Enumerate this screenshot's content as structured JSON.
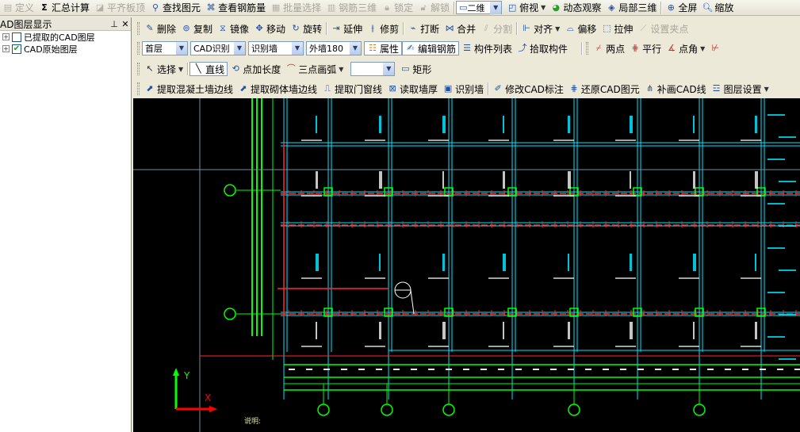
{
  "toolbar1": {
    "define": "定义",
    "sum_calc": "汇总计算",
    "flat_board": "平齐板顶",
    "find_elem": "查找图元",
    "view_rebar": "查看钢筋量",
    "batch_select": "批量选择",
    "rebar_3d": "钢筋三维",
    "lock": "锁定",
    "unlock": "解锁",
    "view_mode": "二维",
    "top_view": "俯视",
    "dynamic_view": "动态观察",
    "local_3d": "局部三维",
    "fullscreen": "全屏",
    "zoom": "缩放"
  },
  "panel": {
    "title": "AD图层显示",
    "items": [
      {
        "label": "已提取的CAD图层",
        "checked": false
      },
      {
        "label": "CAD原始图层",
        "checked": true
      }
    ]
  },
  "toolbar2": {
    "delete": "删除",
    "copy": "复制",
    "mirror": "镜像",
    "move": "移动",
    "rotate": "旋转",
    "extend": "延伸",
    "trim": "修剪",
    "break": "打断",
    "merge": "合并",
    "split": "分割",
    "align": "对齐",
    "offset": "偏移",
    "stretch": "拉伸",
    "set_grip": "设置夹点"
  },
  "toolbar3": {
    "floor": "首层",
    "cad_recog": "CAD识别",
    "recog_wall": "识别墙",
    "wall_type": "外墙180",
    "properties": "属性",
    "edit_rebar": "编辑钢筋",
    "component_list": "构件列表",
    "pick_component": "拾取构件",
    "two_points": "两点",
    "parallel": "平行",
    "point_angle": "点角"
  },
  "toolbar4": {
    "select": "选择",
    "line": "直线",
    "add_length": "点加长度",
    "three_point_arc": "三点画弧",
    "rectangle": "矩形"
  },
  "toolbar5": {
    "extract_concrete": "提取混凝土墙边线",
    "extract_masonry": "提取砌体墙边线",
    "extract_door": "提取门窗线",
    "read_thickness": "读取墙厚",
    "recog_wall": "识别墙",
    "modify_cad": "修改CAD标注",
    "restore_cad": "还原CAD图元",
    "draw_cad_line": "补画CAD线",
    "layer_settings": "图层设置"
  },
  "canvas": {
    "axis_y": "Y",
    "axis_x": "X",
    "note": "说明:"
  },
  "colors": {
    "canvas_bg": "#000000",
    "grid_green": "#00ff00",
    "wall_cyan": "#00e5ff",
    "beam_red": "#ff2a2a",
    "text_white": "#e8e8e8",
    "axis_red": "#ff0000"
  }
}
